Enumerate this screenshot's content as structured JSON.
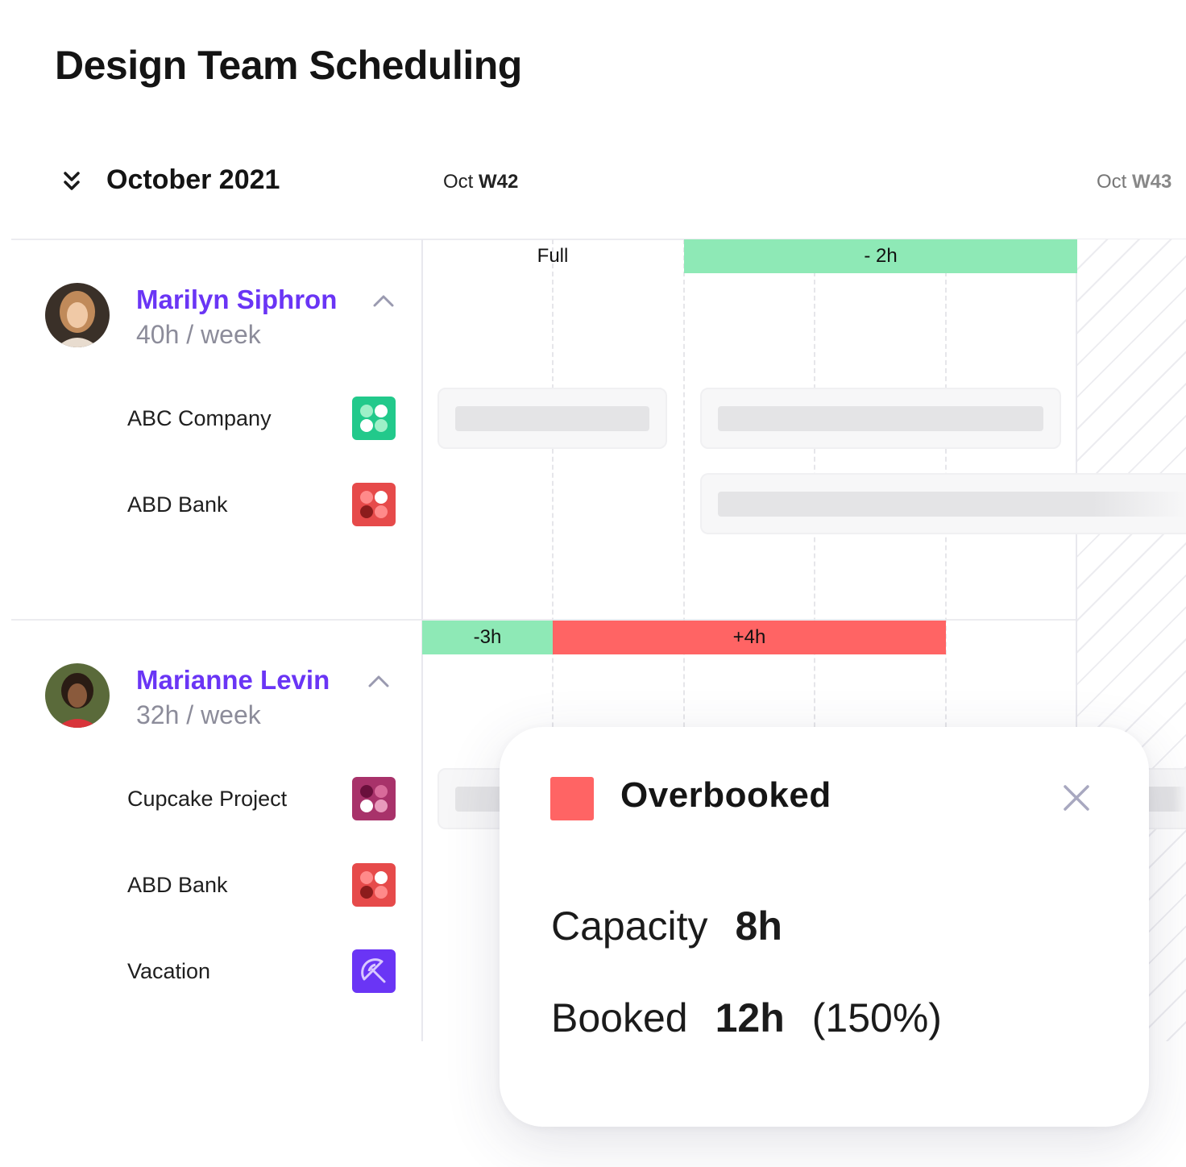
{
  "page": {
    "title": "Design Team Scheduling"
  },
  "toolbar": {
    "month": "October 2021"
  },
  "weeks": [
    {
      "prefix": "Oct",
      "label": "W42"
    },
    {
      "prefix": "Oct",
      "label": "W43"
    }
  ],
  "people": [
    {
      "name": "Marilyn Siphron",
      "hours": "40h / week",
      "capacity_bars": [
        {
          "text": "Full",
          "status": "full"
        },
        {
          "text": "- 2h",
          "status": "under"
        }
      ],
      "projects": [
        {
          "label": "ABC Company",
          "icon": "abc-company-icon",
          "color": "#22c98b"
        },
        {
          "label": "ABD Bank",
          "icon": "abd-bank-icon",
          "color": "#e64a4a"
        }
      ]
    },
    {
      "name": "Marianne Levin",
      "hours": "32h / week",
      "capacity_bars": [
        {
          "text": "-3h",
          "status": "under"
        },
        {
          "text": "+4h",
          "status": "over"
        }
      ],
      "projects": [
        {
          "label": "Cupcake Project",
          "icon": "cupcake-project-icon",
          "color": "#a8326a"
        },
        {
          "label": "ABD Bank",
          "icon": "abd-bank-icon",
          "color": "#e64a4a"
        },
        {
          "label": "Vacation",
          "icon": "umbrella-icon",
          "color": "#6a35f5"
        }
      ]
    }
  ],
  "popup": {
    "title": "Overbooked",
    "capacity_label": "Capacity",
    "capacity_value": "8h",
    "booked_label": "Booked",
    "booked_value": "12h",
    "booked_percent": "(150%)"
  },
  "colors": {
    "accent": "#6a35f5",
    "under": "#8ee9b6",
    "over": "#ff6464",
    "muted": "#8c8c9a"
  }
}
